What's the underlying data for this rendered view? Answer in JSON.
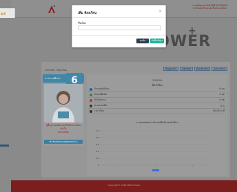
{
  "header": {
    "left_cut_text": "มร",
    "top_right_line1": "ระบบเรียนออนไลน์ MATHS POWER",
    "top_right_line2": "สำหรับนักเรียนระดับชั้นประถมศึกษา"
  },
  "brand": {
    "name": "MATHS POWER",
    "plus": "+"
  },
  "breadcrumb": "หน้าหลัก / ห้องเรียน",
  "actions": [
    "ข้อมูลส่วนตัว",
    "เปลี่ยนรหัส",
    "ตั้งค่าห้องเรียน",
    "ออกจากระบบ"
  ],
  "sidebar": {
    "heading": "ป.ประถมศึกษา",
    "badge": "6",
    "promo": "ปูพื้นฐานคณิตศาสตร์ให้แน่น พร้อมเข้าใจ",
    "promo2": "ทุกบทเรียน",
    "button": "เข้าเรียนห้องเรียนคณิตศาสตร์ ป.6"
  },
  "main": {
    "title": "รายงาน",
    "subtitle": "ห้องเรียน",
    "stats": [
      {
        "label": "จำนวนนักเรียน",
        "value": "0 คน",
        "color": "#1f5fa8"
      },
      {
        "label": "ส่งแบบฝึกหัด",
        "value": "0 ชุด",
        "color": "#2a8a3a"
      },
      {
        "label": "ยังไม่ส่งงาน",
        "value": "0 ชุด",
        "color": "#c03434"
      },
      {
        "label": "คะแนนเฉลี่ย",
        "value": "0 %",
        "color": "#333333"
      },
      {
        "label": "เวลาเรียน",
        "value": "00:00 นาที",
        "color": "#333333"
      }
    ],
    "chart_title": "กราฟแสดงผลการทำแบบฝึกหัดของนักเรียน"
  },
  "chart_data": {
    "type": "bar",
    "categories": [
      "",
      "",
      ""
    ],
    "yticks": [
      "1.0",
      "0.8",
      "0.6",
      "0.4",
      "0.2",
      "0"
    ],
    "values": [
      0,
      0,
      0
    ],
    "ylim": [
      0,
      1
    ],
    "legend_color": "#3b6fd1"
  },
  "footer": {
    "text": "Copyright © 2024 Maths Power"
  },
  "modal": {
    "title": "เพิ่ม ห้องเรียน",
    "close": "×",
    "field_label": "ชื่อห้อง",
    "field_value": "",
    "field_placeholder": "",
    "cancel_label": "ยกเลิก",
    "save_label": "บันทึกข้อมูล"
  }
}
